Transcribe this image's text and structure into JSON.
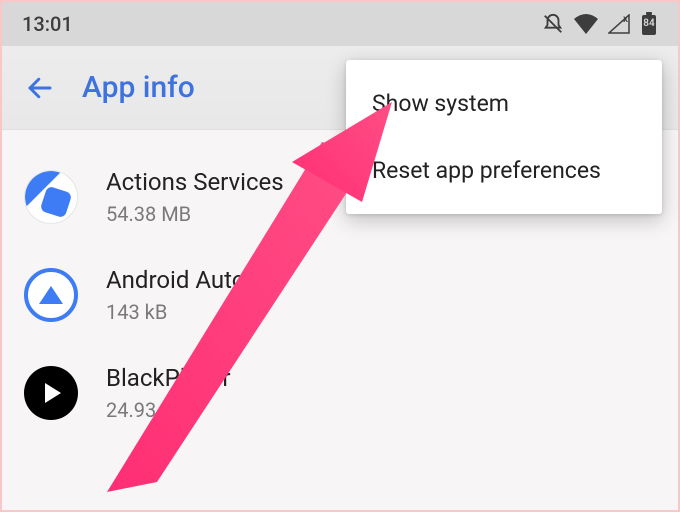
{
  "status_bar": {
    "time": "13:01",
    "battery": "84"
  },
  "header": {
    "title": "App info"
  },
  "apps": [
    {
      "name": "Actions Services",
      "size": "54.38 MB"
    },
    {
      "name": "Android Auto",
      "size": "143 kB"
    },
    {
      "name": "BlackPlayer",
      "size": "24.93 MB"
    }
  ],
  "menu": {
    "items": [
      "Show system",
      "Reset app preferences"
    ]
  }
}
